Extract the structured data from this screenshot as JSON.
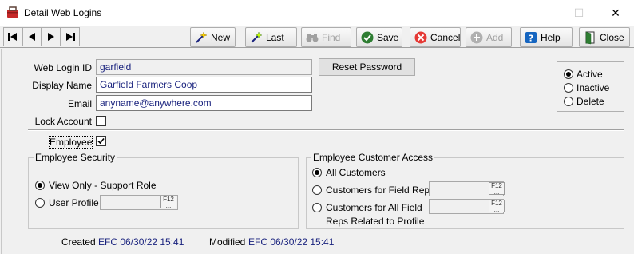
{
  "window": {
    "title": "Detail Web Logins",
    "minimize": "—",
    "maximize": "☐",
    "close": "✕"
  },
  "toolbar": {
    "new_label": "New",
    "last_label": "Last",
    "find_label": "Find",
    "save_label": "Save",
    "cancel_label": "Cancel",
    "add_label": "Add",
    "help_label": "Help",
    "close_label": "Close"
  },
  "form": {
    "web_login_id_label": "Web Login ID",
    "web_login_id_value": "garfield",
    "display_name_label": "Display Name",
    "display_name_value": "Garfield Farmers Coop",
    "email_label": "Email",
    "email_value": "anyname@anywhere.com",
    "lock_account_label": "Lock Account",
    "lock_account_checked": false,
    "reset_password_label": "Reset Password",
    "employee_label": "Employee",
    "employee_checked": true
  },
  "status": {
    "options": [
      "Active",
      "Inactive",
      "Delete"
    ],
    "selected": "Active"
  },
  "employee_security": {
    "title": "Employee Security",
    "view_only_label": "View Only - Support Role",
    "user_profile_label": "User Profile",
    "user_profile_value": "",
    "selected": "View Only - Support Role"
  },
  "customer_access": {
    "title": "Employee Customer Access",
    "all_customers_label": "All Customers",
    "field_rep_label": "Customers for Field Rep",
    "all_field_label": "Customers for All Field",
    "all_field_label2": "Reps Related to Profile",
    "selected": "All Customers"
  },
  "lookup": {
    "key_label": "F12",
    "dots": "..."
  },
  "audit": {
    "created_label": "Created",
    "created_value": "EFC 06/30/22 15:41",
    "modified_label": "Modified",
    "modified_value": "EFC 06/30/22 15:41"
  }
}
